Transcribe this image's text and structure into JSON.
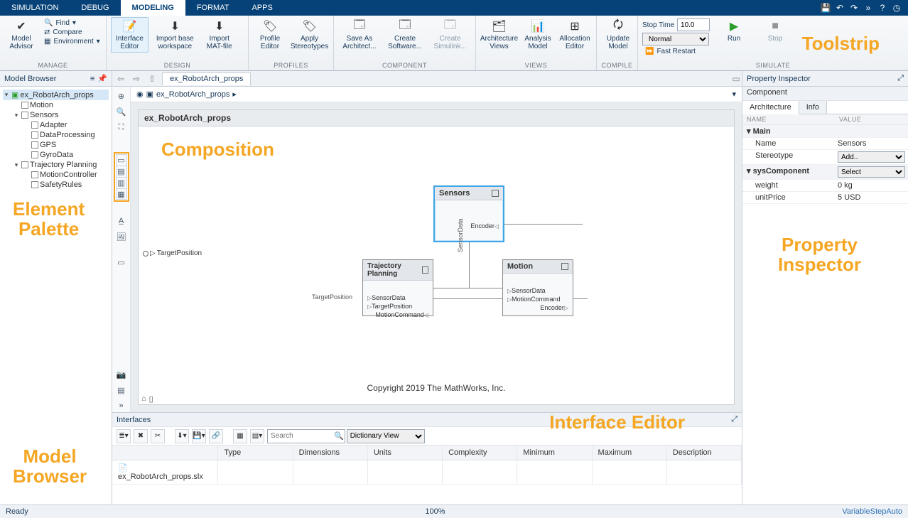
{
  "tabs": [
    "SIMULATION",
    "DEBUG",
    "MODELING",
    "FORMAT",
    "APPS"
  ],
  "activeTab": "MODELING",
  "toolstrip": {
    "groups": {
      "manage": {
        "label": "MANAGE",
        "model_advisor": "Model\nAdvisor",
        "find": "Find",
        "compare": "Compare",
        "environment": "Environment"
      },
      "design": {
        "label": "DESIGN",
        "interface_editor": "Interface\nEditor",
        "import_base": "Import base\nworkspace",
        "import_mat": "Import\nMAT-file"
      },
      "profiles": {
        "label": "PROFILES",
        "profile_editor": "Profile\nEditor",
        "apply_stereotypes": "Apply\nStereotypes"
      },
      "component": {
        "label": "COMPONENT",
        "save_as": "Save As\nArchitect...",
        "create_software": "Create\nSoftware...",
        "create_simulink": "Create\nSimulink..."
      },
      "views": {
        "label": "VIEWS",
        "arch_views": "Architecture\nViews",
        "analysis_model": "Analysis\nModel",
        "allocation_editor": "Allocation\nEditor"
      },
      "compile": {
        "label": "COMPILE",
        "update_model": "Update\nModel"
      },
      "simulate": {
        "label": "SIMULATE",
        "stop_time_label": "Stop Time",
        "stop_time_value": "10.0",
        "mode": "Normal",
        "fast_restart": "Fast Restart",
        "run": "Run",
        "stop": "Stop"
      }
    },
    "overlay": "Toolstrip"
  },
  "modelBrowser": {
    "title": "Model Browser",
    "overlay": "Model\nBrowser",
    "tree": [
      {
        "label": "ex_RobotArch_props",
        "indent": 0,
        "expanded": true,
        "selected": true,
        "icon": "sys"
      },
      {
        "label": "Motion",
        "indent": 1
      },
      {
        "label": "Sensors",
        "indent": 1,
        "expanded": true
      },
      {
        "label": "Adapter",
        "indent": 2
      },
      {
        "label": "DataProcessing",
        "indent": 2
      },
      {
        "label": "GPS",
        "indent": 2
      },
      {
        "label": "GyroData",
        "indent": 2
      },
      {
        "label": "Trajectory Planning",
        "indent": 1,
        "expanded": true
      },
      {
        "label": "MotionController",
        "indent": 2
      },
      {
        "label": "SafetyRules",
        "indent": 2
      }
    ]
  },
  "palette": {
    "overlay": "Element\nPalette"
  },
  "editor": {
    "tab": "ex_RobotArch_props",
    "breadcrumb": "ex_RobotArch_props",
    "canvas_title": "ex_RobotArch_props",
    "overlay": "Composition",
    "copyright": "Copyright 2019 The MathWorks, Inc.",
    "ext_port": "TargetPosition",
    "blocks": {
      "sensors": {
        "title": "Sensors",
        "port_out": "Encoder"
      },
      "trajectory": {
        "title": "Trajectory Planning",
        "ports_in": [
          "SensorData",
          "TargetPosition"
        ],
        "port_in_right": "MotionCommand"
      },
      "motion": {
        "title": "Motion",
        "ports_in": [
          "SensorData",
          "MotionCommand"
        ],
        "port_out": "Encoder"
      }
    },
    "wire_label": "SensorData",
    "ext_label_left": "TargetPosition"
  },
  "interfaces": {
    "title": "Interfaces",
    "overlay": "Interface Editor",
    "search_placeholder": "Search",
    "view": "Dictionary View",
    "columns": [
      "",
      "Type",
      "Dimensions",
      "Units",
      "Complexity",
      "Minimum",
      "Maximum",
      "Description"
    ],
    "row0": "ex_RobotArch_props.slx"
  },
  "propertyInspector": {
    "title": "Property Inspector",
    "sub": "Component",
    "tabs": [
      "Architecture",
      "Info"
    ],
    "overlay": "Property\nInspector",
    "cols": [
      "NAME",
      "VALUE"
    ],
    "rows": [
      {
        "section": "Main"
      },
      {
        "k": "Name",
        "v": "Sensors"
      },
      {
        "k": "Stereotype",
        "v": "Add..",
        "select": true
      },
      {
        "section": "sysComponent",
        "select": true,
        "v": "Select"
      },
      {
        "k": "weight",
        "v": "0 kg"
      },
      {
        "k": "unitPrice",
        "v": "5 USD"
      }
    ]
  },
  "status": {
    "left": "Ready",
    "center": "100%",
    "right": "VariableStepAuto"
  }
}
